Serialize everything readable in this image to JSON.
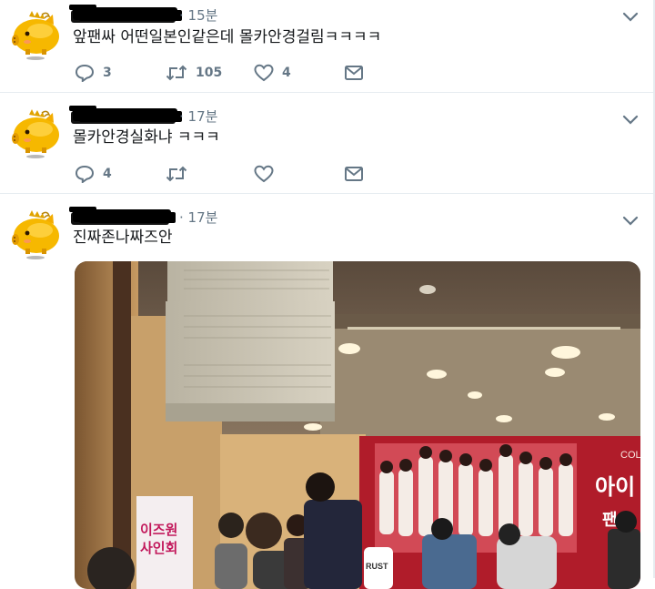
{
  "tweets": [
    {
      "time": "· 15분",
      "text": "앞팬싸 어떤일본인같은데 몰카안경걸림ㅋㅋㅋㅋ",
      "actions": {
        "reply_count": "3",
        "retweet_count": "105",
        "like_count": "4"
      }
    },
    {
      "time": "· 17분",
      "text": "몰카안경실화냐 ㅋㅋㅋ",
      "actions": {
        "reply_count": "4",
        "retweet_count": "",
        "like_count": ""
      }
    },
    {
      "time": "· 17분",
      "text": "진짜존나짜즈안",
      "media": {
        "banner_text_top": "COL",
        "banner_text_mid": "아이",
        "banner_text_low": "팬",
        "standee_line1": "이즈원",
        "standee_line2": "사인회",
        "badge_text": "RUST"
      }
    }
  ],
  "colors": {
    "icon_gray": "#657786",
    "border": "#e6ecf0",
    "text": "#14171a",
    "banner_red": "#b01c2a"
  },
  "icons": [
    "avatar-pig",
    "chevron-down",
    "reply",
    "retweet",
    "like",
    "dm-envelope"
  ]
}
